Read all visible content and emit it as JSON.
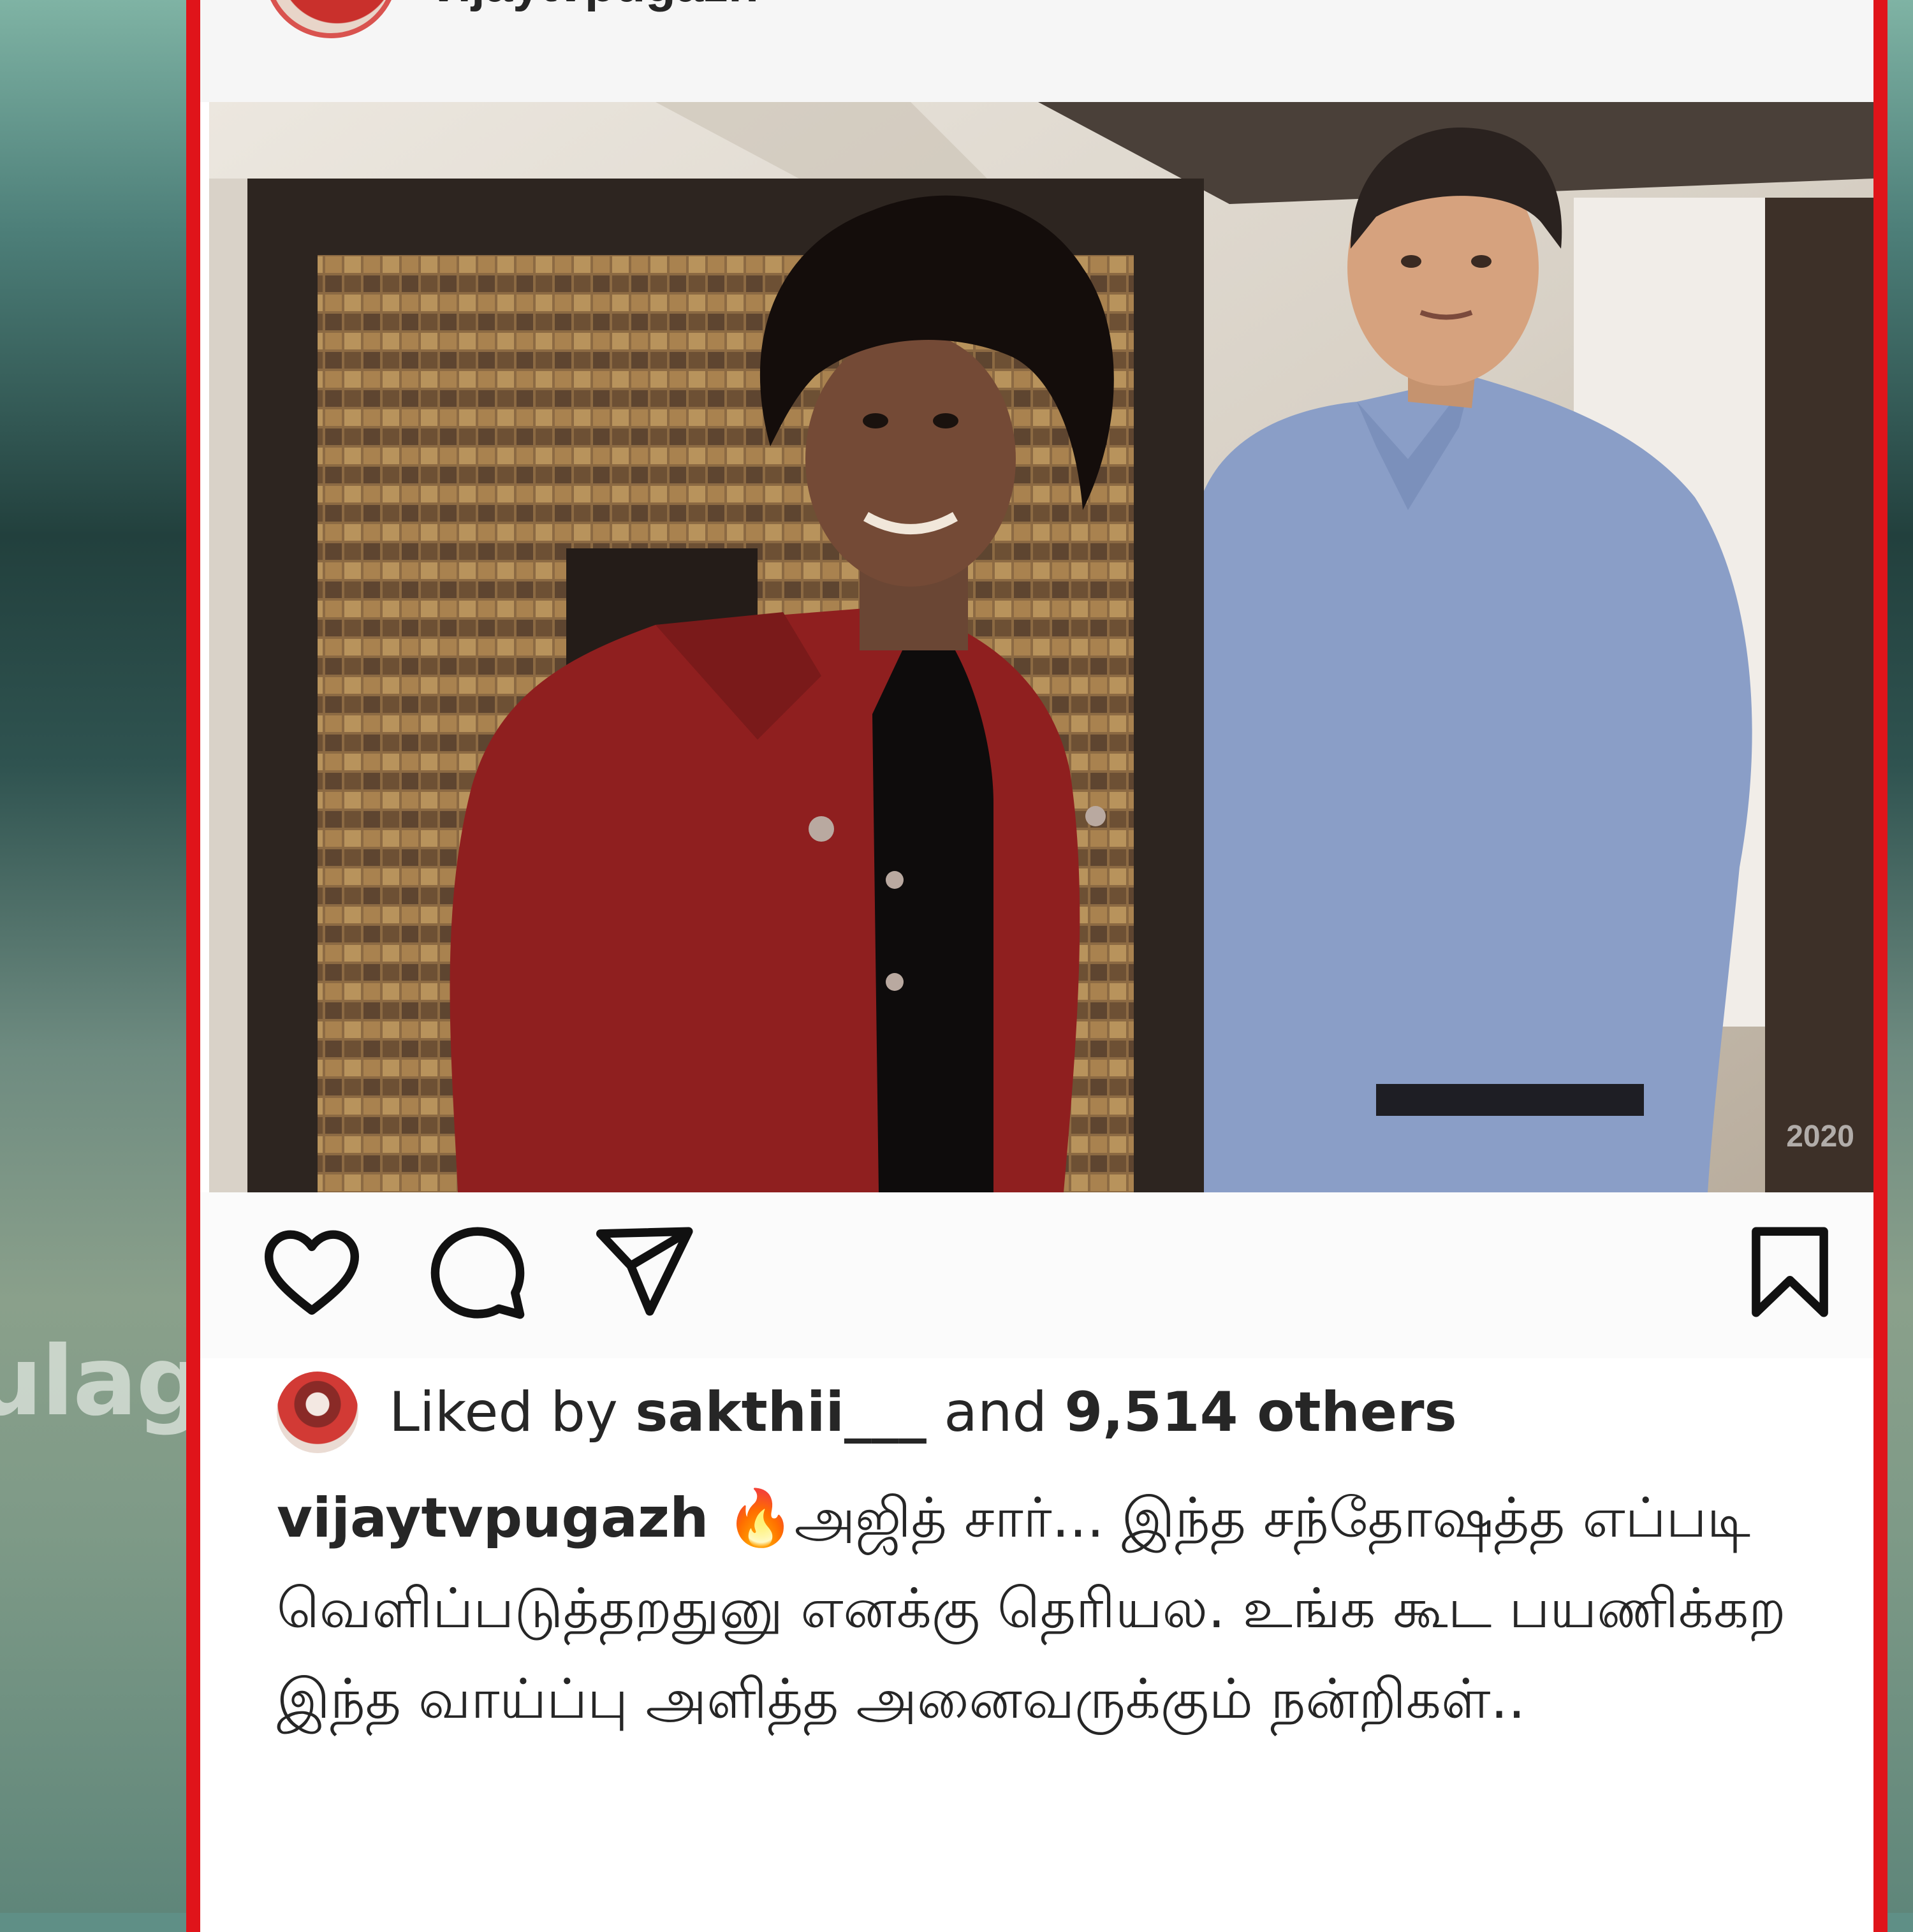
{
  "post": {
    "username": "vijaytvpugazh",
    "photo_watermark": "2020",
    "liked_by_prefix": "Liked by",
    "liked_by_user": "sakthii___",
    "liked_by_middle": "and",
    "liked_by_count": "9,514 others",
    "caption_username": "vijaytvpugazh",
    "caption_emoji": "🔥",
    "caption_text": "அஜித் சார்... இந்த சந்தோஷத்த எப்படி வெளிப்படுத்தறதுனு எனக்கு தெரியல. உங்க கூட பயணிக்கற இந்த வாய்ப்பு அளித்த அனைவருக்கும் நன்றிகள்.."
  },
  "background": {
    "partial_text": "ulag"
  },
  "colors": {
    "frame_border": "#e0141a",
    "text": "#262626"
  },
  "icons": {
    "like": "heart-icon",
    "comment": "comment-icon",
    "share": "send-icon",
    "save": "bookmark-icon",
    "more": "more-options-icon"
  }
}
